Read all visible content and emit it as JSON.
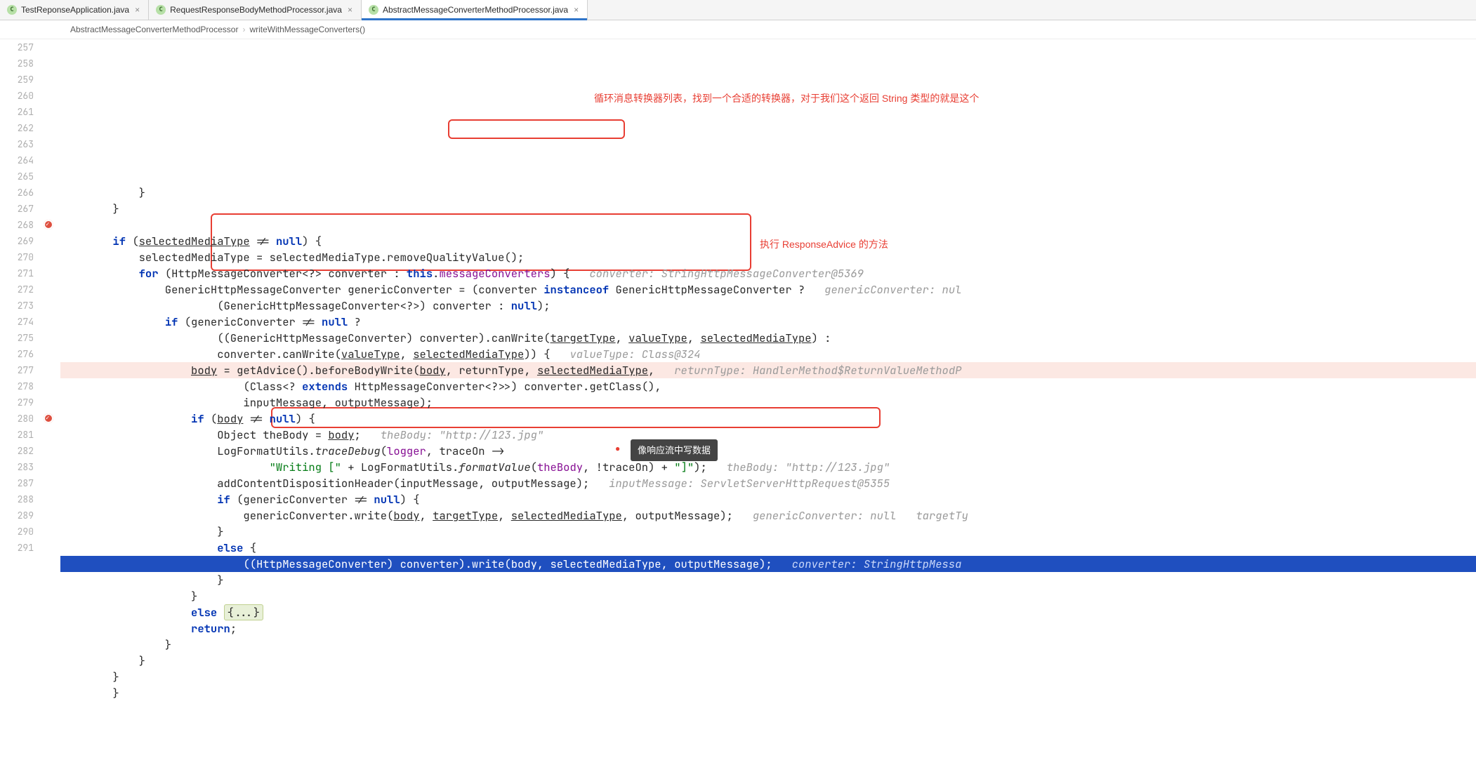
{
  "tabs": [
    {
      "label": "TestReponseApplication.java",
      "active": false
    },
    {
      "label": "RequestResponseBodyMethodProcessor.java",
      "active": false
    },
    {
      "label": "AbstractMessageConverterMethodProcessor.java",
      "active": true
    }
  ],
  "breadcrumbs": [
    "AbstractMessageConverterMethodProcessor",
    "writeWithMessageConverters()"
  ],
  "first_line": 257,
  "lines": [
    {
      "n": 257,
      "indent": 12,
      "raw": "}"
    },
    {
      "n": 258,
      "indent": 8,
      "raw": "}"
    },
    {
      "n": 259,
      "indent": 0,
      "raw": ""
    },
    {
      "n": 260,
      "indent": 8,
      "parts": [
        [
          "kw",
          "if"
        ],
        [
          "",
          " ("
        ],
        [
          "ul",
          "selectedMediaType"
        ],
        [
          "",
          " != "
        ],
        [
          "kw",
          "null"
        ],
        [
          "",
          ") {"
        ]
      ]
    },
    {
      "n": 261,
      "indent": 12,
      "parts": [
        [
          "",
          "selectedMediaType = selectedMediaType.removeQualityValue();"
        ]
      ]
    },
    {
      "n": 262,
      "indent": 12,
      "parts": [
        [
          "kw",
          "for"
        ],
        [
          "",
          " (HttpMessageConverter<?> converter : "
        ],
        [
          "kw",
          "this"
        ],
        [
          "",
          "."
        ],
        [
          "fld",
          "messageConverters"
        ],
        [
          "",
          ") {   "
        ],
        [
          "hint",
          "converter: StringHttpMessageConverter@5369"
        ]
      ]
    },
    {
      "n": 263,
      "indent": 16,
      "parts": [
        [
          "",
          "GenericHttpMessageConverter genericConverter = (converter "
        ],
        [
          "kw",
          "instanceof"
        ],
        [
          "",
          " GenericHttpMessageConverter ?   "
        ],
        [
          "hint",
          "genericConverter: nul"
        ]
      ]
    },
    {
      "n": 264,
      "indent": 24,
      "parts": [
        [
          "",
          "(GenericHttpMessageConverter<?>) converter : "
        ],
        [
          "kw",
          "null"
        ],
        [
          "",
          ");"
        ]
      ]
    },
    {
      "n": 265,
      "indent": 16,
      "parts": [
        [
          "kw",
          "if"
        ],
        [
          "",
          " (genericConverter != "
        ],
        [
          "kw",
          "null"
        ],
        [
          "",
          " ?"
        ]
      ]
    },
    {
      "n": 266,
      "indent": 24,
      "parts": [
        [
          "",
          "((GenericHttpMessageConverter) converter).canWrite("
        ],
        [
          "ul",
          "targetType"
        ],
        [
          "",
          ", "
        ],
        [
          "ul",
          "valueType"
        ],
        [
          "",
          ", "
        ],
        [
          "ul",
          "selectedMediaType"
        ],
        [
          "",
          ") :"
        ]
      ]
    },
    {
      "n": 267,
      "indent": 24,
      "parts": [
        [
          "",
          "converter.canWrite("
        ],
        [
          "ul",
          "valueType"
        ],
        [
          "",
          ", "
        ],
        [
          "ul",
          "selectedMediaType"
        ],
        [
          "",
          ")) {   "
        ],
        [
          "hint",
          "valueType: Class@324"
        ]
      ]
    },
    {
      "n": 268,
      "indent": 20,
      "bp": true,
      "parts": [
        [
          "ul",
          "body"
        ],
        [
          "",
          " = getAdvice().beforeBodyWrite("
        ],
        [
          "ul",
          "body"
        ],
        [
          "",
          ", returnType, "
        ],
        [
          "ul",
          "selectedMediaType"
        ],
        [
          "",
          ",   "
        ],
        [
          "hint",
          "returnType: HandlerMethod$ReturnValueMethodP"
        ]
      ]
    },
    {
      "n": 269,
      "indent": 28,
      "parts": [
        [
          "",
          "(Class<? "
        ],
        [
          "kw",
          "extends"
        ],
        [
          "",
          " HttpMessageConverter<?>>) converter.getClass(),"
        ]
      ]
    },
    {
      "n": 270,
      "indent": 28,
      "parts": [
        [
          "",
          "inputMessage, outputMessage);"
        ]
      ]
    },
    {
      "n": 271,
      "indent": 20,
      "parts": [
        [
          "kw",
          "if"
        ],
        [
          "",
          " ("
        ],
        [
          "ul",
          "body"
        ],
        [
          "",
          " != "
        ],
        [
          "kw",
          "null"
        ],
        [
          "",
          ") {"
        ]
      ]
    },
    {
      "n": 272,
      "indent": 24,
      "parts": [
        [
          "",
          "Object theBody = "
        ],
        [
          "ul",
          "body"
        ],
        [
          "",
          ";   "
        ],
        [
          "hint",
          "theBody: \"http://123.jpg\""
        ]
      ]
    },
    {
      "n": 273,
      "indent": 24,
      "parts": [
        [
          "",
          "LogFormatUtils."
        ],
        [
          "mth",
          "traceDebug"
        ],
        [
          "",
          "("
        ],
        [
          "fld",
          "logger"
        ],
        [
          "",
          ", traceOn ->"
        ]
      ]
    },
    {
      "n": 274,
      "indent": 32,
      "parts": [
        [
          "str",
          "\"Writing [\""
        ],
        [
          "",
          " + LogFormatUtils."
        ],
        [
          "mth",
          "formatValue"
        ],
        [
          "",
          "("
        ],
        [
          "fld",
          "theBody"
        ],
        [
          "",
          ", !traceOn) + "
        ],
        [
          "str",
          "\"]\""
        ],
        [
          "",
          ");   "
        ],
        [
          "hint",
          "theBody: \"http://123.jpg\""
        ]
      ]
    },
    {
      "n": 275,
      "indent": 24,
      "parts": [
        [
          "",
          "addContentDispositionHeader(inputMessage, outputMessage);   "
        ],
        [
          "hint",
          "inputMessage: ServletServerHttpRequest@5355"
        ]
      ]
    },
    {
      "n": 276,
      "indent": 24,
      "parts": [
        [
          "kw",
          "if"
        ],
        [
          "",
          " (genericConverter != "
        ],
        [
          "kw",
          "null"
        ],
        [
          "",
          ") {"
        ]
      ]
    },
    {
      "n": 277,
      "indent": 28,
      "parts": [
        [
          "",
          "genericConverter.write("
        ],
        [
          "ul",
          "body"
        ],
        [
          "",
          ", "
        ],
        [
          "ul",
          "targetType"
        ],
        [
          "",
          ", "
        ],
        [
          "ul",
          "selectedMediaType"
        ],
        [
          "",
          ", outputMessage);   "
        ],
        [
          "hint",
          "genericConverter: null   targetTy"
        ]
      ]
    },
    {
      "n": 278,
      "indent": 24,
      "parts": [
        [
          "",
          "}"
        ]
      ]
    },
    {
      "n": 279,
      "indent": 24,
      "parts": [
        [
          "kw",
          "else"
        ],
        [
          "",
          " {"
        ]
      ]
    },
    {
      "n": 280,
      "indent": 28,
      "exec": true,
      "bp": true,
      "parts": [
        [
          "",
          "((HttpMessageConverter) converter).write(body, selectedMediaType, outputMessage);   "
        ],
        [
          "hint",
          "converter: StringHttpMessa"
        ]
      ]
    },
    {
      "n": 281,
      "indent": 24,
      "parts": [
        [
          "",
          "}"
        ]
      ]
    },
    {
      "n": 282,
      "indent": 20,
      "parts": [
        [
          "",
          "}"
        ]
      ]
    },
    {
      "n": 283,
      "indent": 20,
      "parts": [
        [
          "kw",
          "else"
        ],
        [
          "",
          " "
        ],
        [
          "fold",
          "{...}"
        ]
      ]
    },
    {
      "n": 287,
      "indent": 20,
      "parts": [
        [
          "kw",
          "return"
        ],
        [
          "",
          ";"
        ]
      ]
    },
    {
      "n": 288,
      "indent": 16,
      "parts": [
        [
          "",
          "}"
        ]
      ]
    },
    {
      "n": 289,
      "indent": 12,
      "parts": [
        [
          "",
          "}"
        ]
      ]
    },
    {
      "n": 290,
      "indent": 8,
      "parts": [
        [
          "",
          "}"
        ]
      ]
    },
    {
      "n": 291,
      "indent": 8,
      "parts": [
        [
          "",
          "}"
        ]
      ]
    }
  ],
  "annotations": {
    "comment1": "循环消息转换器列表，找到一个合适的转换器，对于我们这个返回 String 类型的就是这个",
    "comment2": "执行 ResponseAdvice 的方法",
    "tooltip": "像响应流中写数据"
  }
}
